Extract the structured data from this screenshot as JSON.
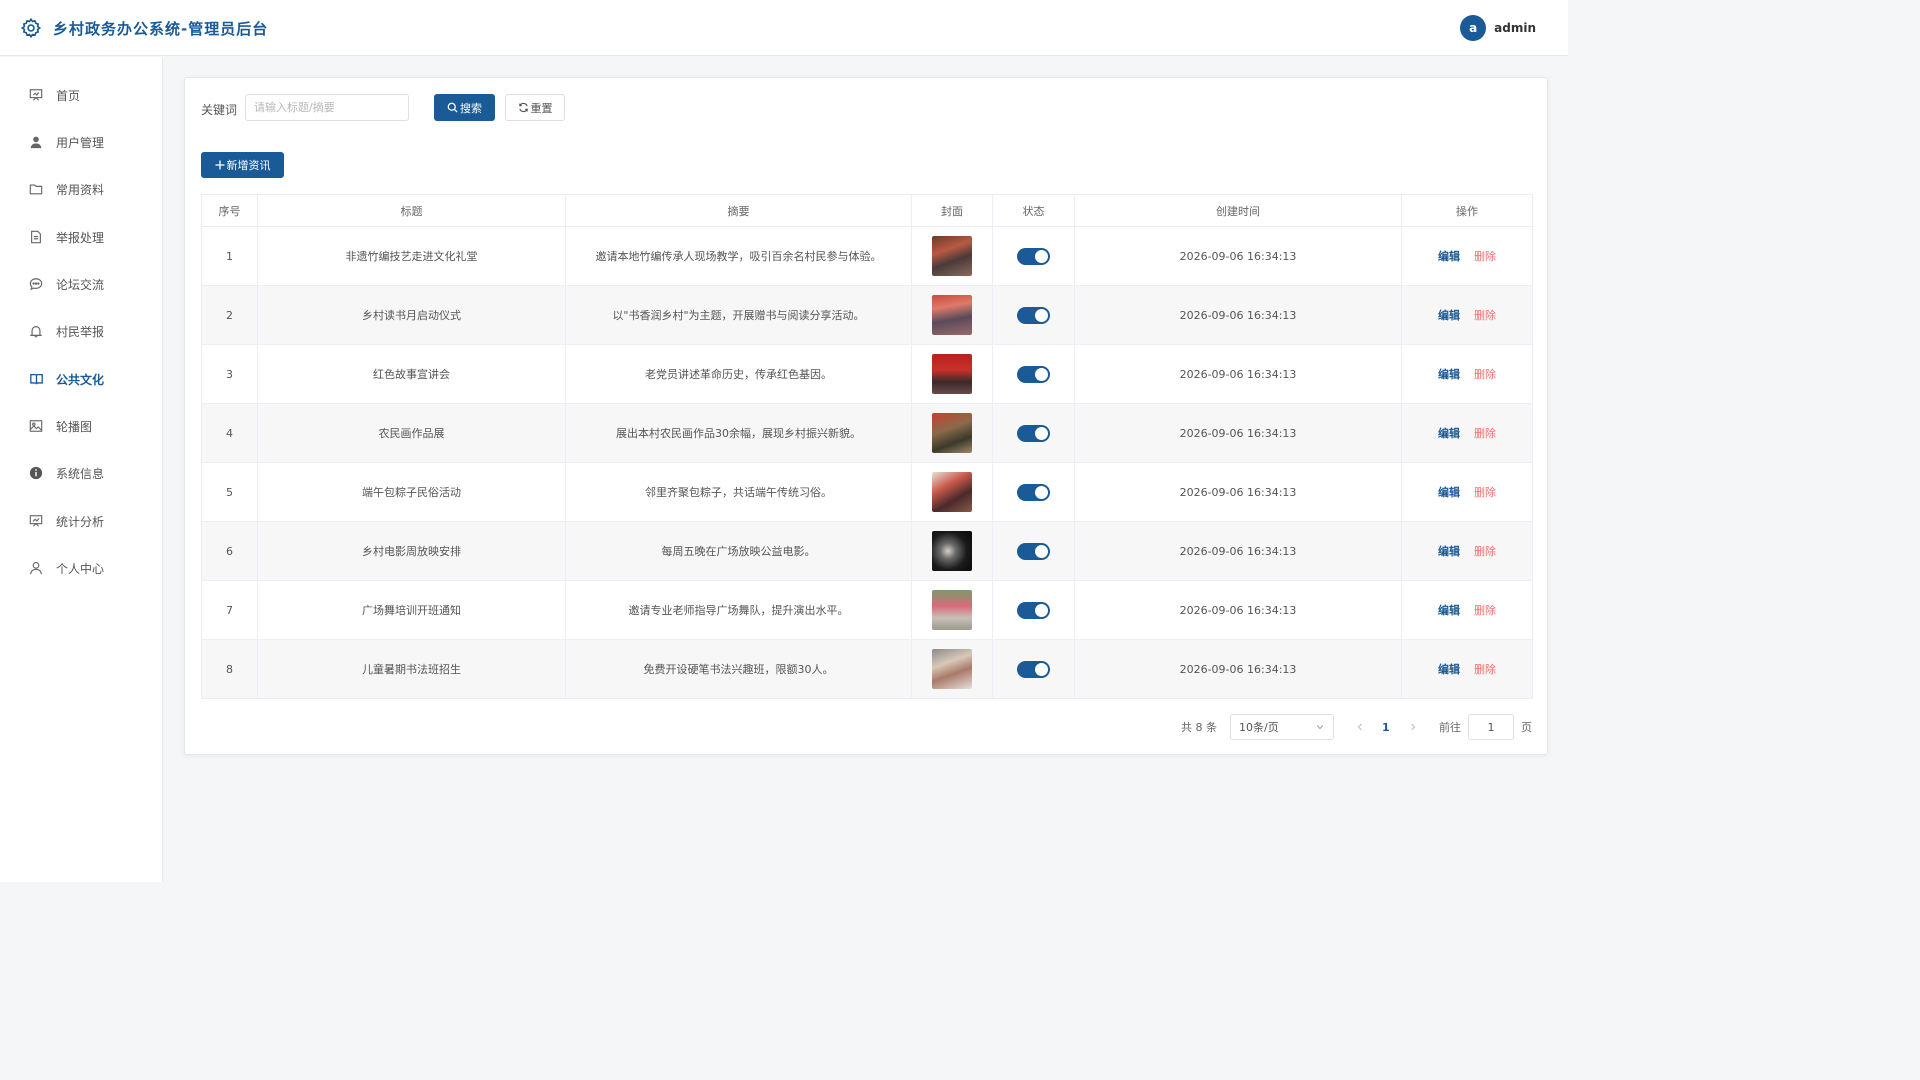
{
  "header": {
    "title": "乡村政务办公系统-管理员后台",
    "avatar_letter": "a",
    "username": "admin",
    "brand_color": "#1a5a96"
  },
  "sidebar": {
    "items": [
      {
        "label": "首页",
        "icon": "dashboard-icon"
      },
      {
        "label": "用户管理",
        "icon": "user-icon"
      },
      {
        "label": "常用资料",
        "icon": "folder-icon"
      },
      {
        "label": "举报处理",
        "icon": "document-icon"
      },
      {
        "label": "论坛交流",
        "icon": "chat-icon"
      },
      {
        "label": "村民举报",
        "icon": "bell-icon"
      },
      {
        "label": "公共文化",
        "icon": "book-icon",
        "active": true
      },
      {
        "label": "轮播图",
        "icon": "picture-icon"
      },
      {
        "label": "系统信息",
        "icon": "info-icon"
      },
      {
        "label": "统计分析",
        "icon": "chart-icon"
      },
      {
        "label": "个人中心",
        "icon": "person-icon"
      }
    ]
  },
  "search": {
    "keyword_label": "关键词",
    "placeholder": "请输入标题/摘要",
    "value": "",
    "search_label": "搜索",
    "reset_label": "重置"
  },
  "toolbar": {
    "add_label": "新增资讯"
  },
  "table": {
    "columns": [
      "序号",
      "标题",
      "摘要",
      "封面",
      "状态",
      "创建时间",
      "操作"
    ],
    "edit_label": "编辑",
    "delete_label": "删除",
    "rows": [
      {
        "index": "1",
        "title": "非遗竹编技艺走进文化礼堂",
        "summary": "邀请本地竹编传承人现场教学，吸引百余名村民参与体验。",
        "created": "2026-09-06 16:34:13",
        "enabled": true
      },
      {
        "index": "2",
        "title": "乡村读书月启动仪式",
        "summary": "以\"书香润乡村\"为主题，开展赠书与阅读分享活动。",
        "created": "2026-09-06 16:34:13",
        "enabled": true
      },
      {
        "index": "3",
        "title": "红色故事宣讲会",
        "summary": "老党员讲述革命历史，传承红色基因。",
        "created": "2026-09-06 16:34:13",
        "enabled": true
      },
      {
        "index": "4",
        "title": "农民画作品展",
        "summary": "展出本村农民画作品30余幅，展现乡村振兴新貌。",
        "created": "2026-09-06 16:34:13",
        "enabled": true
      },
      {
        "index": "5",
        "title": "端午包粽子民俗活动",
        "summary": "邻里齐聚包粽子，共话端午传统习俗。",
        "created": "2026-09-06 16:34:13",
        "enabled": true
      },
      {
        "index": "6",
        "title": "乡村电影周放映安排",
        "summary": "每周五晚在广场放映公益电影。",
        "created": "2026-09-06 16:34:13",
        "enabled": true
      },
      {
        "index": "7",
        "title": "广场舞培训开班通知",
        "summary": "邀请专业老师指导广场舞队，提升演出水平。",
        "created": "2026-09-06 16:34:13",
        "enabled": true
      },
      {
        "index": "8",
        "title": "儿童暑期书法班招生",
        "summary": "免费开设硬笔书法兴趣班，限额30人。",
        "created": "2026-09-06 16:34:13",
        "enabled": true
      }
    ]
  },
  "pagination": {
    "total_text": "共 8 条",
    "page_size": "10条/页",
    "current_page": "1",
    "goto_label": "前往",
    "goto_value": "1",
    "page_suffix": "页"
  }
}
